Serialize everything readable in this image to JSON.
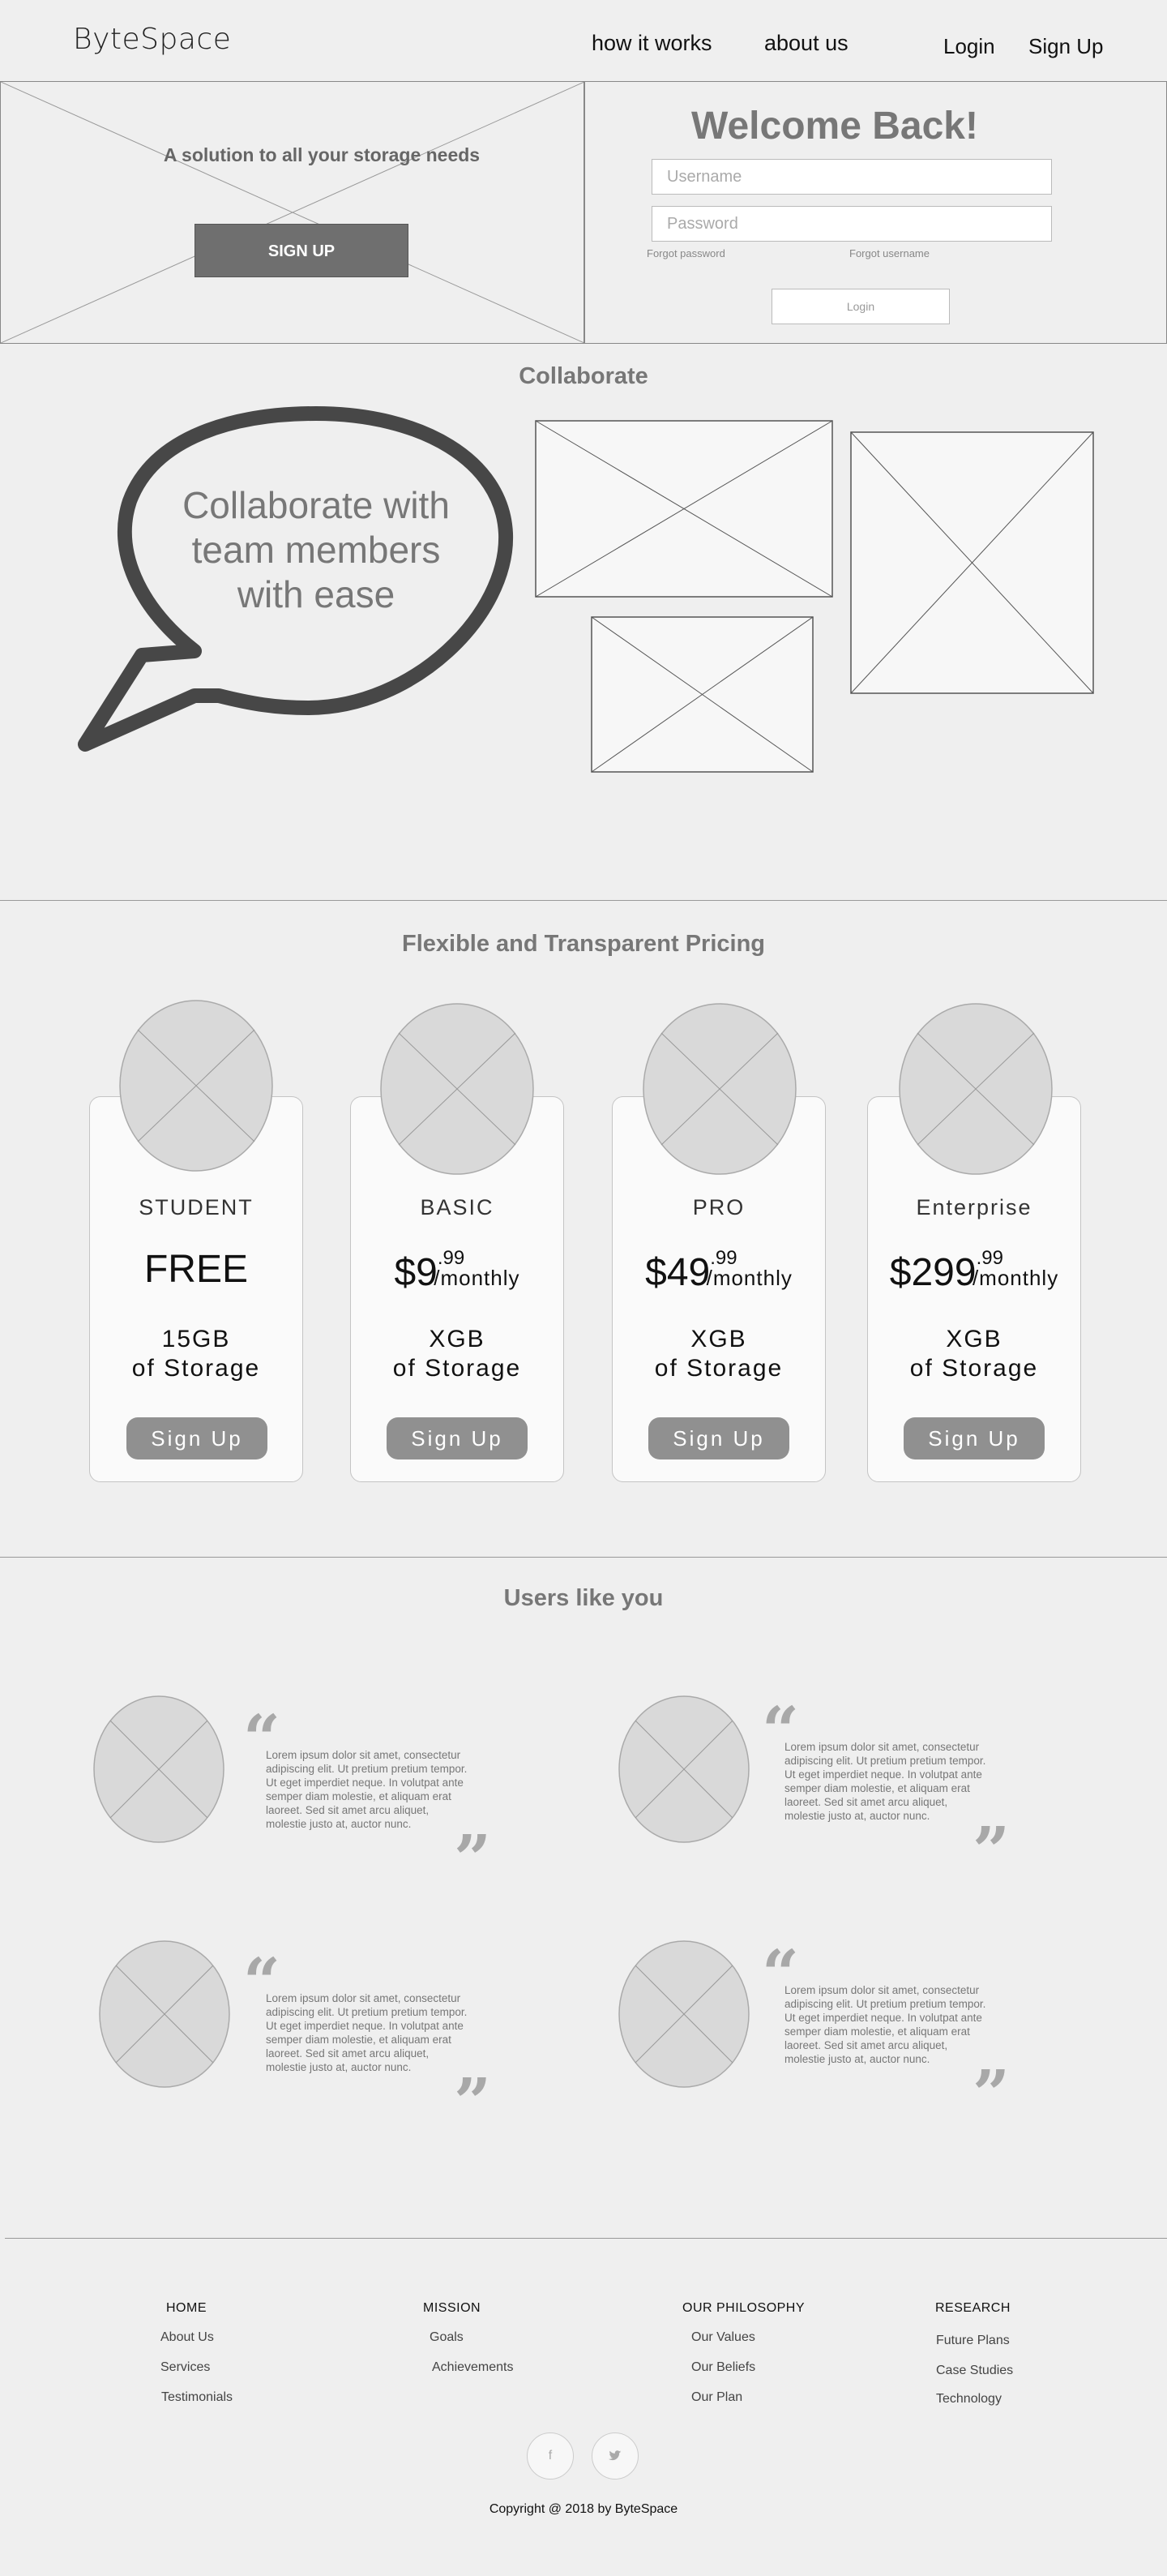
{
  "nav": {
    "logo": "ByteSpace",
    "links": [
      "how it works",
      "about us"
    ],
    "login": "Login",
    "signup": "Sign Up"
  },
  "hero": {
    "tagline": "A solution to all your storage needs",
    "signup_button": "SIGN UP",
    "welcome": "Welcome Back!",
    "username_placeholder": "Username",
    "password_placeholder": "Password",
    "forgot_password": "Forgot password",
    "forgot_username": "Forgot username",
    "login_button": "Login"
  },
  "collaborate": {
    "title": "Collaborate",
    "bubble_text": "Collaborate with team members with ease"
  },
  "pricing": {
    "title": "Flexible and Transparent Pricing",
    "plans": [
      {
        "name": "STUDENT",
        "price": "FREE",
        "cents": "",
        "period": "",
        "storage_line1": "15GB",
        "storage_line2": "of Storage",
        "button": "Sign Up"
      },
      {
        "name": "BASIC",
        "price": "$9",
        "cents": ".99",
        "period": "/monthly",
        "storage_line1": "XGB",
        "storage_line2": "of Storage",
        "button": "Sign Up"
      },
      {
        "name": "PRO",
        "price": "$49",
        "cents": ".99",
        "period": "/monthly",
        "storage_line1": "XGB",
        "storage_line2": "of Storage",
        "button": "Sign Up"
      },
      {
        "name": "Enterprise",
        "price": "$299",
        "cents": ".99",
        "period": "/monthly",
        "storage_line1": "XGB",
        "storage_line2": "of Storage",
        "button": "Sign Up"
      }
    ]
  },
  "testimonials": {
    "title": "Users like you",
    "items": [
      {
        "text": "Lorem ipsum dolor sit amet, consectetur adipiscing elit. Ut pretium pretium tempor. Ut eget imperdiet neque. In volutpat ante semper diam molestie, et aliquam erat laoreet. Sed sit amet arcu aliquet, molestie justo at, auctor nunc."
      },
      {
        "text": "Lorem ipsum dolor sit amet, consectetur adipiscing elit. Ut pretium pretium tempor. Ut eget imperdiet neque. In volutpat ante semper diam molestie, et aliquam erat laoreet. Sed sit amet arcu aliquet, molestie justo at, auctor nunc."
      },
      {
        "text": "Lorem ipsum dolor sit amet, consectetur adipiscing elit. Ut pretium pretium tempor. Ut eget imperdiet neque. In volutpat ante semper diam molestie, et aliquam erat laoreet. Sed sit amet arcu aliquet, molestie justo at, auctor nunc."
      },
      {
        "text": "Lorem ipsum dolor sit amet, consectetur adipiscing elit. Ut pretium pretium tempor. Ut eget imperdiet neque. In volutpat ante semper diam molestie, et aliquam erat laoreet. Sed sit amet arcu aliquet, molestie justo at, auctor nunc."
      }
    ]
  },
  "footer": {
    "columns": [
      {
        "heading": "HOME",
        "links": [
          "About Us",
          "Services",
          "Testimonials"
        ]
      },
      {
        "heading": "MISSION",
        "links": [
          "Goals",
          "Achievements"
        ]
      },
      {
        "heading": "OUR PHILOSOPHY",
        "links": [
          "Our Values",
          "Our Beliefs",
          "Our Plan"
        ]
      },
      {
        "heading": "RESEARCH",
        "links": [
          "Future Plans",
          "Case Studies",
          "Technology"
        ]
      }
    ],
    "social": [
      {
        "icon": "facebook-icon",
        "glyph": "f"
      },
      {
        "icon": "twitter-icon",
        "glyph": "❧"
      }
    ],
    "copyright": "Copyright @ 2018 by ByteSpace"
  },
  "colors": {
    "background": "#efefef",
    "heading_gray": "#777777",
    "button_dark": "#6f6f6f",
    "button_plan": "#909090",
    "placeholder_fill": "#d9d9d9"
  }
}
